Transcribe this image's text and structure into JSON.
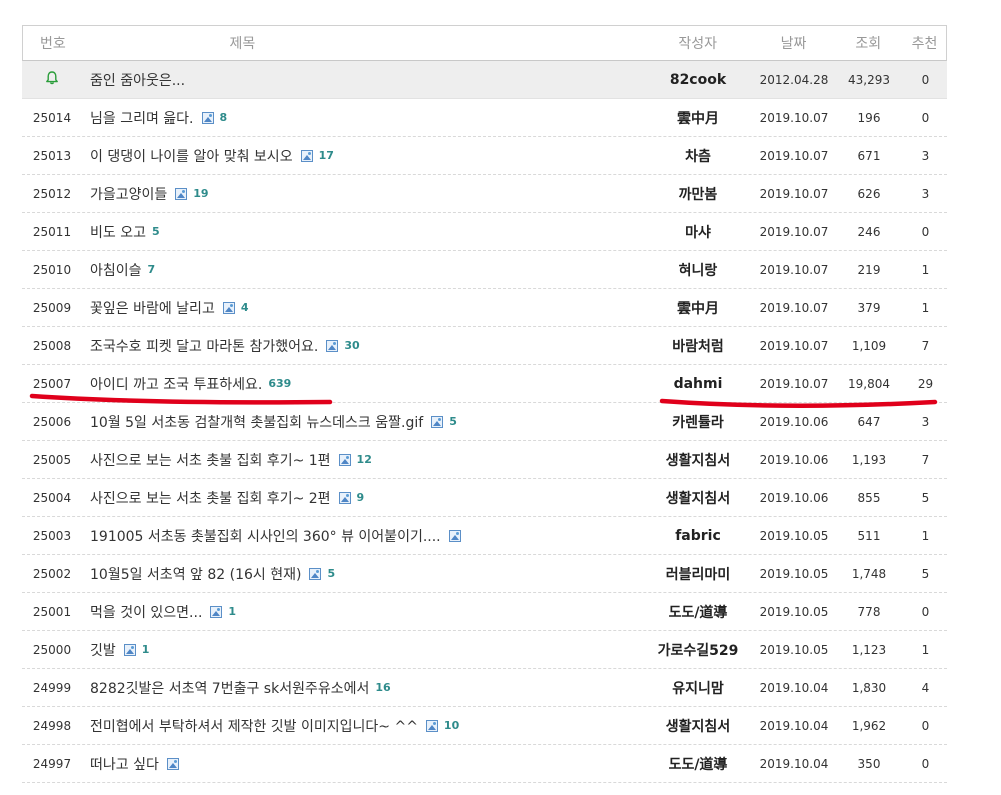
{
  "header": {
    "num": "번호",
    "title": "제목",
    "author": "작성자",
    "date": "날짜",
    "views": "조회",
    "rec": "추천"
  },
  "notice": {
    "title": "줌인 줌아웃은...",
    "author": "82cook",
    "date": "2012.04.28",
    "views": "43,293",
    "rec": "0",
    "icon": "bell-icon",
    "icon_color": "#2a9d3a"
  },
  "rows": [
    {
      "num": "25014",
      "title": "님을 그리며 읊다.",
      "img": true,
      "comments": "8",
      "author": "雲中月",
      "date": "2019.10.07",
      "views": "196",
      "rec": "0"
    },
    {
      "num": "25013",
      "title": "이 댕댕이 나이를 알아 맞춰 보시오",
      "img": true,
      "comments": "17",
      "author": "차츰",
      "date": "2019.10.07",
      "views": "671",
      "rec": "3"
    },
    {
      "num": "25012",
      "title": "가을고양이들",
      "img": true,
      "comments": "19",
      "author": "까만봄",
      "date": "2019.10.07",
      "views": "626",
      "rec": "3"
    },
    {
      "num": "25011",
      "title": "비도 오고",
      "img": false,
      "comments": "5",
      "author": "마샤",
      "date": "2019.10.07",
      "views": "246",
      "rec": "0"
    },
    {
      "num": "25010",
      "title": "아침이슬",
      "img": false,
      "comments": "7",
      "author": "혀니랑",
      "date": "2019.10.07",
      "views": "219",
      "rec": "1"
    },
    {
      "num": "25009",
      "title": "꽃잎은 바람에 날리고",
      "img": true,
      "comments": "4",
      "author": "雲中月",
      "date": "2019.10.07",
      "views": "379",
      "rec": "1"
    },
    {
      "num": "25008",
      "title": "조국수호 피켓 달고 마라톤 참가했어요.",
      "img": true,
      "comments": "30",
      "author": "바람처럼",
      "date": "2019.10.07",
      "views": "1,109",
      "rec": "7"
    },
    {
      "num": "25007",
      "title": "아이디 까고 조국 투표하세요.",
      "img": false,
      "comments": "639",
      "author": "dahmi",
      "date": "2019.10.07",
      "views": "19,804",
      "rec": "29"
    },
    {
      "num": "25006",
      "title": "10월 5일 서초동 검찰개혁 촛불집회 뉴스데스크 움짤.gif",
      "img": true,
      "comments": "5",
      "author": "카렌튤라",
      "date": "2019.10.06",
      "views": "647",
      "rec": "3"
    },
    {
      "num": "25005",
      "title": "사진으로 보는 서초 촛불 집회 후기~ 1편",
      "img": true,
      "comments": "12",
      "author": "생활지침서",
      "date": "2019.10.06",
      "views": "1,193",
      "rec": "7"
    },
    {
      "num": "25004",
      "title": "사진으로 보는 서초 촛불 집회 후기~ 2편",
      "img": true,
      "comments": "9",
      "author": "생활지침서",
      "date": "2019.10.06",
      "views": "855",
      "rec": "5"
    },
    {
      "num": "25003",
      "title": "191005 서초동 촛불집회 시사인의 360° 뷰 이어붙이기....",
      "img": true,
      "comments": "",
      "author": "fabric",
      "date": "2019.10.05",
      "views": "511",
      "rec": "1"
    },
    {
      "num": "25002",
      "title": "10월5일 서초역 앞 82 (16시 현재)",
      "img": true,
      "comments": "5",
      "author": "러블리마미",
      "date": "2019.10.05",
      "views": "1,748",
      "rec": "5"
    },
    {
      "num": "25001",
      "title": "먹을 것이 있으면...",
      "img": true,
      "comments": "1",
      "author": "도도/道導",
      "date": "2019.10.05",
      "views": "778",
      "rec": "0"
    },
    {
      "num": "25000",
      "title": "깃발",
      "img": true,
      "comments": "1",
      "author": "가로수길529",
      "date": "2019.10.05",
      "views": "1,123",
      "rec": "1"
    },
    {
      "num": "24999",
      "title": "8282깃발은 서초역 7번출구 sk서원주유소에서",
      "img": false,
      "comments": "16",
      "author": "유지니맘",
      "date": "2019.10.04",
      "views": "1,830",
      "rec": "4"
    },
    {
      "num": "24998",
      "title": "전미협에서 부탁하셔서 제작한 깃발 이미지입니다~ ^^",
      "img": true,
      "comments": "10",
      "author": "생활지침서",
      "date": "2019.10.04",
      "views": "1,962",
      "rec": "0"
    },
    {
      "num": "24997",
      "title": "떠나고 싶다",
      "img": true,
      "comments": "",
      "author": "도도/道導",
      "date": "2019.10.04",
      "views": "350",
      "rec": "0"
    }
  ],
  "annotation": {
    "color": "#e0001b"
  }
}
